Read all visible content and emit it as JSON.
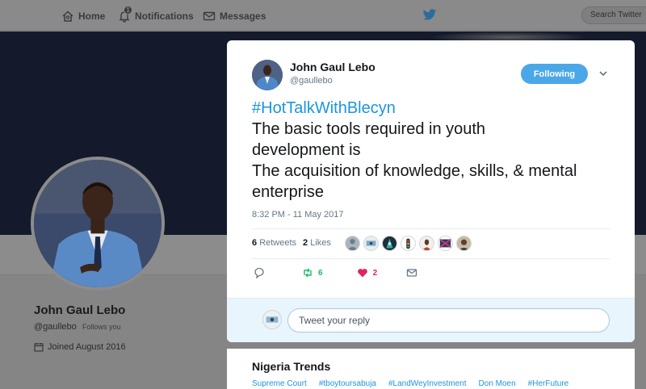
{
  "topbar": {
    "home_label": "Home",
    "notifications_label": "Notifications",
    "notifications_badge": "1",
    "messages_label": "Messages",
    "search_placeholder": "Search Twitter"
  },
  "profile": {
    "name": "John Gaul Lebo",
    "handle": "@gaullebo",
    "follows_you": "Follows you",
    "joined": "Joined August 2016"
  },
  "tweet": {
    "author_name": "John Gaul Lebo",
    "author_handle": "@gaullebo",
    "follow_button": "Following",
    "hashtag": "#HotTalkWithBlecyn",
    "lines": [
      "The basic tools required in youth",
      "development is",
      "The acquisition of knowledge, skills, & mental",
      "enterprise"
    ],
    "timestamp": "8:32 PM - 11 May 2017",
    "retweets_count": "6",
    "retweets_label": "Retweets",
    "likes_count": "2",
    "likes_label": "Likes",
    "action_retweet_count": "6",
    "action_like_count": "2",
    "reply_placeholder": "Tweet your reply"
  },
  "trends": {
    "title": "Nigeria Trends",
    "items": [
      "Supreme Court",
      "#tboytoursabuja",
      "#LandWeyInvestment",
      "Don Moen",
      "#HerFuture"
    ]
  },
  "colors": {
    "accent": "#1b95e0",
    "follow_button": "#4aa7e8",
    "retweet": "#17bf63",
    "like": "#e0245e",
    "icon_gray": "#657786"
  }
}
